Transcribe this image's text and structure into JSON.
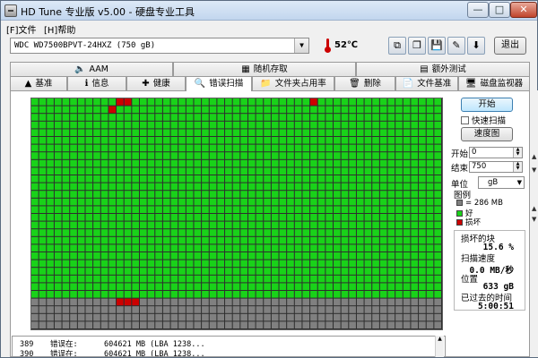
{
  "window": {
    "title": "HD Tune 专业版 v5.00 - 硬盘专业工具",
    "minimize": "—",
    "maximize": "□",
    "close": "✕"
  },
  "menu": {
    "file": "[F]文件",
    "help": "[H]帮助"
  },
  "toolbar": {
    "drive": "WDC WD7500BPVT-24HXZ      (750 gB)",
    "temperature": "52℃",
    "exit_label": "退出",
    "buttons": [
      {
        "icon": "copy-icon",
        "glyph": "⧉"
      },
      {
        "icon": "copy-alt-icon",
        "glyph": "❐"
      },
      {
        "icon": "save-icon",
        "glyph": "💾"
      },
      {
        "icon": "tools-icon",
        "glyph": "✎"
      },
      {
        "icon": "download-icon",
        "glyph": "⬇"
      }
    ]
  },
  "tabs_top": [
    {
      "label": "AAM",
      "icon": "speaker-icon",
      "glyph": "🔈"
    },
    {
      "label": "随机存取",
      "icon": "random-access-icon",
      "glyph": "▦"
    },
    {
      "label": "额外测试",
      "icon": "extra-test-icon",
      "glyph": "▤"
    }
  ],
  "tabs_bottom": [
    {
      "label": "基准",
      "icon": "benchmark-icon",
      "glyph": "▲"
    },
    {
      "label": "信息",
      "icon": "info-icon",
      "glyph": "ℹ"
    },
    {
      "label": "健康",
      "icon": "health-icon",
      "glyph": "✚"
    },
    {
      "label": "错误扫描",
      "icon": "error-scan-icon",
      "glyph": "🔍",
      "active": true
    },
    {
      "label": "文件夹占用率",
      "icon": "folder-icon",
      "glyph": "📁"
    },
    {
      "label": "删除",
      "icon": "delete-icon",
      "glyph": "🗑"
    },
    {
      "label": "文件基准",
      "icon": "file-benchmark-icon",
      "glyph": "📄"
    },
    {
      "label": "磁盘监视器",
      "icon": "disk-monitor-icon",
      "glyph": "🖥"
    }
  ],
  "scan": {
    "start_label": "开始",
    "quick_scan_label": "快速扫描",
    "map_label": "速度图",
    "start_field_label": "开始",
    "start_value": "0",
    "end_field_label": "结束",
    "end_value": "750",
    "unit_label": "单位",
    "unit_value": "gB",
    "legend_title": "图例",
    "legend": [
      {
        "label": "= 286 MB",
        "color": "#808080"
      },
      {
        "label": "好",
        "color": "#19d219"
      },
      {
        "label": "损坏",
        "color": "#cc0000"
      }
    ],
    "stats": {
      "damaged_label": "损坏的块",
      "damaged_value": "15.6 %",
      "speed_label": "扫描速度",
      "speed_value": "0.0 MB/秒",
      "position_label": "位置",
      "position_value": "633 gB",
      "elapsed_label": "已过去的时间",
      "elapsed_value": "5:00:51"
    },
    "grid": {
      "cols": 53,
      "rows": 30,
      "scanned_rows": 26,
      "good_color": "#19d219",
      "bad_color": "#cc0000",
      "unscanned_color": "#808080",
      "bad_cells": [
        [
          0,
          11
        ],
        [
          0,
          12
        ],
        [
          0,
          36
        ],
        [
          1,
          10
        ],
        [
          26,
          11
        ],
        [
          26,
          12
        ],
        [
          26,
          13
        ]
      ]
    }
  },
  "log": [
    {
      "id": "389",
      "msg": "错误在:",
      "detail": "604621 MB (LBA 1238..."
    },
    {
      "id": "390",
      "msg": "错误在:",
      "detail": "604621 MB (LBA 1238..."
    }
  ]
}
